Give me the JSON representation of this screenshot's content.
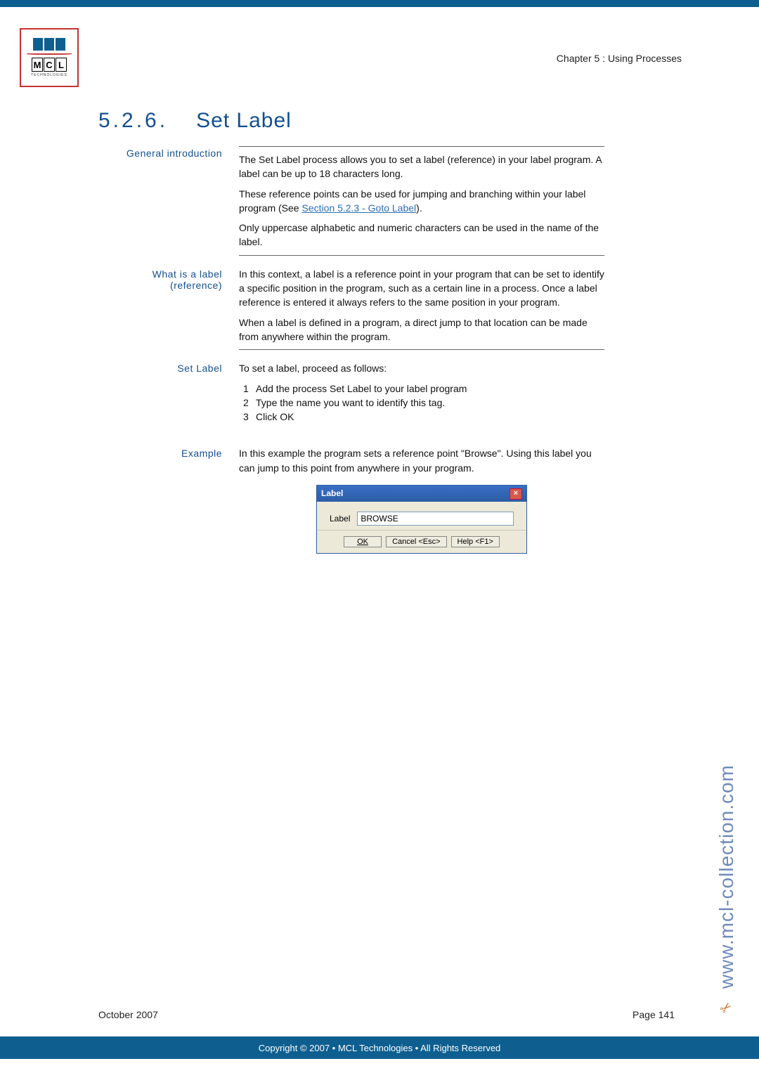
{
  "header": {
    "chapter": "Chapter 5 : Using Processes"
  },
  "logo": {
    "letters": [
      "M",
      "C",
      "L"
    ],
    "sub": "TECHNOLOGIES"
  },
  "heading": {
    "number": "5.2.6.",
    "title": "Set Label"
  },
  "sections": {
    "general": {
      "label": "General introduction",
      "p1": "The Set Label process allows you to set a label (reference) in your label program. A label can be up to 18 characters long.",
      "p2a": "These reference points can be used for jumping and branching within your label program (See ",
      "p2link": "Section 5.2.3 - Goto Label",
      "p2b": ").",
      "p3": "Only uppercase alphabetic and numeric characters can be used in the name of the label."
    },
    "whatis": {
      "label1": "What is a label",
      "label2": "(reference)",
      "p1": "In this context, a label is a reference point in your program that can be set to identify a specific position in the program, such as a certain line in a process. Once a label reference is entered it always refers to the same position in your program.",
      "p2": "When a label is defined in a program, a direct jump to that location can be made from anywhere within the program."
    },
    "setlabel": {
      "label": "Set Label",
      "intro": "To set a label, proceed as follows:",
      "steps": [
        {
          "n": "1",
          "t": "Add the process Set Label to your label program"
        },
        {
          "n": "2",
          "t": "Type the name you want to identify this tag."
        },
        {
          "n": "3",
          "t": "Click OK"
        }
      ]
    },
    "example": {
      "label": "Example",
      "p1": "In this example the program sets a reference point \"Browse\". Using this label you can jump to this point from anywhere in your program."
    }
  },
  "dialog": {
    "title": "Label",
    "fieldLabel": "Label",
    "fieldValue": "BROWSE",
    "ok": "OK",
    "cancel": "Cancel <Esc>",
    "help": "Help <F1>"
  },
  "side": {
    "url": "www.mcl-collection.com",
    "scissor": "✂"
  },
  "footer": {
    "date": "October 2007",
    "page": "Page 141"
  },
  "copyright": "Copyright © 2007 • MCL Technologies • All Rights Reserved"
}
